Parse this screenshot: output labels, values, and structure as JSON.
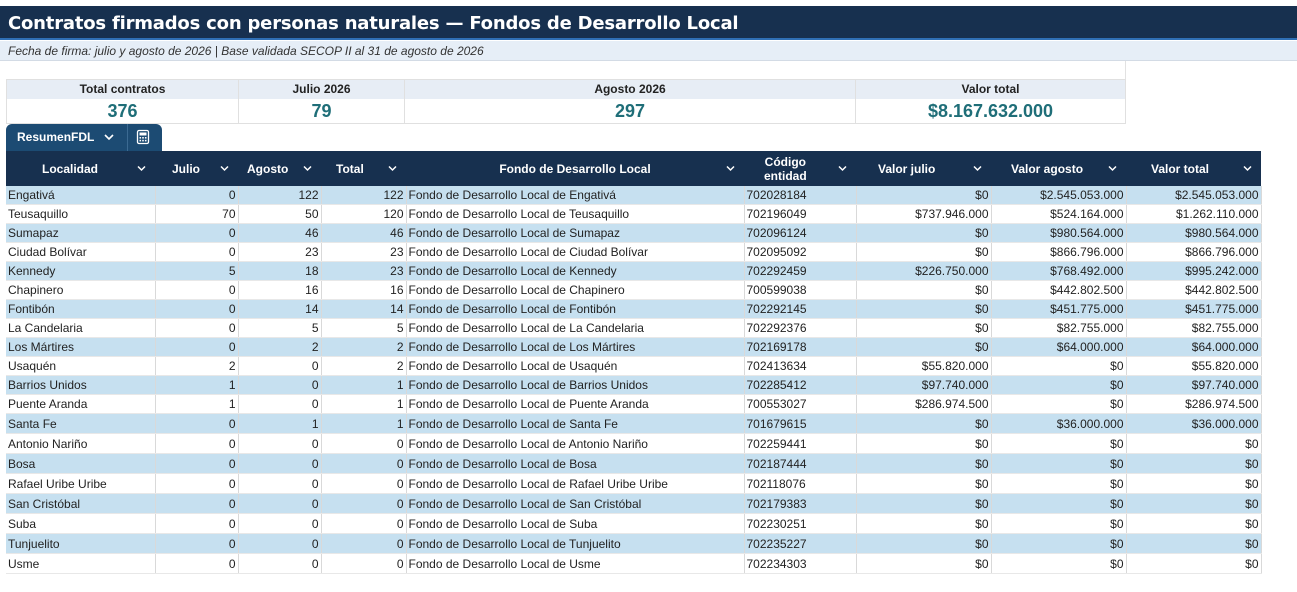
{
  "title": "Contratos firmados con personas naturales — Fondos de Desarrollo Local",
  "subtitle": "Fecha de firma: julio y agosto de 2026 | Base validada SECOP II al 31 de agosto de 2026",
  "kpis": [
    {
      "label": "Total contratos",
      "value": "376"
    },
    {
      "label": "Julio 2026",
      "value": "79"
    },
    {
      "label": "Agosto 2026",
      "value": "297"
    },
    {
      "label": "Valor total",
      "value": "$8.167.632.000"
    }
  ],
  "sheet_tab": {
    "name": "ResumenFDL",
    "icons": [
      "chevron-down-icon",
      "calculator-icon"
    ]
  },
  "table": {
    "headers": [
      "Localidad",
      "Julio",
      "Agosto",
      "Total",
      "Fondo de Desarrollo Local",
      "Código entidad",
      "Valor julio",
      "Valor agosto",
      "Valor total"
    ],
    "header_lines": {
      "codigo_1": "Código",
      "codigo_2": "entidad"
    },
    "rows": [
      [
        "Engativá",
        "0",
        "122",
        "122",
        "Fondo de Desarrollo Local de Engativá",
        "702028184",
        "$0",
        "$2.545.053.000",
        "$2.545.053.000"
      ],
      [
        "Teusaquillo",
        "70",
        "50",
        "120",
        "Fondo de Desarrollo Local de Teusaquillo",
        "702196049",
        "$737.946.000",
        "$524.164.000",
        "$1.262.110.000"
      ],
      [
        "Sumapaz",
        "0",
        "46",
        "46",
        "Fondo de Desarrollo Local de Sumapaz",
        "702096124",
        "$0",
        "$980.564.000",
        "$980.564.000"
      ],
      [
        "Ciudad Bolívar",
        "0",
        "23",
        "23",
        "Fondo de Desarrollo Local de Ciudad Bolívar",
        "702095092",
        "$0",
        "$866.796.000",
        "$866.796.000"
      ],
      [
        "Kennedy",
        "5",
        "18",
        "23",
        "Fondo de Desarrollo Local de Kennedy",
        "702292459",
        "$226.750.000",
        "$768.492.000",
        "$995.242.000"
      ],
      [
        "Chapinero",
        "0",
        "16",
        "16",
        "Fondo de Desarrollo Local de Chapinero",
        "700599038",
        "$0",
        "$442.802.500",
        "$442.802.500"
      ],
      [
        "Fontibón",
        "0",
        "14",
        "14",
        "Fondo de Desarrollo Local de Fontibón",
        "702292145",
        "$0",
        "$451.775.000",
        "$451.775.000"
      ],
      [
        "La Candelaria",
        "0",
        "5",
        "5",
        "Fondo de Desarrollo Local de La Candelaria",
        "702292376",
        "$0",
        "$82.755.000",
        "$82.755.000"
      ],
      [
        "Los Mártires",
        "0",
        "2",
        "2",
        "Fondo de Desarrollo Local de Los Mártires",
        "702169178",
        "$0",
        "$64.000.000",
        "$64.000.000"
      ],
      [
        "Usaquén",
        "2",
        "0",
        "2",
        "Fondo de Desarrollo Local de Usaquén",
        "702413634",
        "$55.820.000",
        "$0",
        "$55.820.000"
      ],
      [
        "Barrios Unidos",
        "1",
        "0",
        "1",
        "Fondo de Desarrollo Local de Barrios Unidos",
        "702285412",
        "$97.740.000",
        "$0",
        "$97.740.000"
      ],
      [
        "Puente Aranda",
        "1",
        "0",
        "1",
        "Fondo de Desarrollo Local de Puente Aranda",
        "700553027",
        "$286.974.500",
        "$0",
        "$286.974.500"
      ],
      [
        "Santa Fe",
        "0",
        "1",
        "1",
        "Fondo de Desarrollo Local de Santa Fe",
        "701679615",
        "$0",
        "$36.000.000",
        "$36.000.000"
      ],
      [
        "Antonio Nariño",
        "0",
        "0",
        "0",
        "Fondo de Desarrollo Local de Antonio Nariño",
        "702259441",
        "$0",
        "$0",
        "$0"
      ],
      [
        "Bosa",
        "0",
        "0",
        "0",
        "Fondo de Desarrollo Local de Bosa",
        "702187444",
        "$0",
        "$0",
        "$0"
      ],
      [
        "Rafael Uribe Uribe",
        "0",
        "0",
        "0",
        "Fondo de Desarrollo Local de Rafael Uribe Uribe",
        "702118076",
        "$0",
        "$0",
        "$0"
      ],
      [
        "San Cristóbal",
        "0",
        "0",
        "0",
        "Fondo de Desarrollo Local de San Cristóbal",
        "702179383",
        "$0",
        "$0",
        "$0"
      ],
      [
        "Suba",
        "0",
        "0",
        "0",
        "Fondo de Desarrollo Local de Suba",
        "702230251",
        "$0",
        "$0",
        "$0"
      ],
      [
        "Tunjuelito",
        "0",
        "0",
        "0",
        "Fondo de Desarrollo Local de Tunjuelito",
        "702235227",
        "$0",
        "$0",
        "$0"
      ],
      [
        "Usme",
        "0",
        "0",
        "0",
        "Fondo de Desarrollo Local de Usme",
        "702234303",
        "$0",
        "$0",
        "$0"
      ]
    ]
  },
  "colors": {
    "header_bg": "#17304f",
    "band": "#c6e0f0",
    "kpi_value": "#1f6e78",
    "tab_bg": "#1c4b73"
  }
}
